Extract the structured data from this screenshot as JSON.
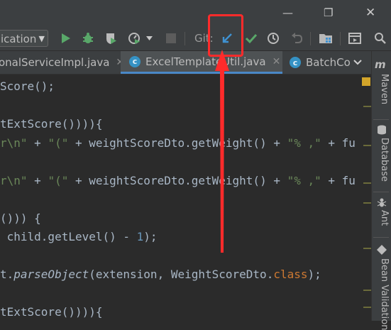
{
  "toolbar": {
    "run_config": "ication",
    "git_label": "Git:"
  },
  "tabs": [
    {
      "label": "onalServiceImpl.java",
      "icon": "java-class-icon"
    },
    {
      "label": "ExcelTemplateUtil.java",
      "icon": "java-class-icon",
      "icon_letter": "c",
      "active": true
    },
    {
      "label": "BatchCo",
      "icon": "java-class-icon",
      "icon_letter": "c"
    }
  ],
  "tool_windows": [
    "Maven",
    "Database",
    "Ant",
    "Bean Validation"
  ],
  "maven_glyph": "m",
  "code_lines": [
    [
      [
        "Score();",
        "t-tx"
      ]
    ],
    [],
    [
      [
        "tExtScore()))){",
        "t-tx"
      ]
    ],
    [
      [
        "r\\n\"",
        "t-s"
      ],
      [
        " + ",
        "t-tx"
      ],
      [
        "\"(\"",
        "t-s"
      ],
      [
        " + weightScoreDto.getWeight() + ",
        "t-tx"
      ],
      [
        "\"% ,\"",
        "t-s"
      ],
      [
        " + fu",
        "t-tx"
      ]
    ],
    [],
    [
      [
        "r\\n\"",
        "t-s"
      ],
      [
        " + ",
        "t-tx"
      ],
      [
        "\"(\"",
        "t-s"
      ],
      [
        " + weightScoreDto.getWeight() + ",
        "t-tx"
      ],
      [
        "\"% ,\"",
        "t-s"
      ],
      [
        " + fu",
        "t-tx"
      ]
    ],
    [],
    [
      [
        "())) {",
        "t-tx"
      ]
    ],
    [
      [
        " child.getLevel() - ",
        "t-tx"
      ],
      [
        "1",
        "t-n"
      ],
      [
        ");",
        "t-tx"
      ]
    ],
    [],
    [
      [
        "t.",
        "t-tx"
      ],
      [
        "parseObject",
        "t-it"
      ],
      [
        "(extension, WeightScoreDto.",
        "t-tx"
      ],
      [
        "class",
        "t-k"
      ],
      [
        ");",
        "t-tx"
      ]
    ],
    [],
    [
      [
        "tExtScore()))){",
        "t-tx"
      ]
    ]
  ],
  "colors": {
    "highlight_box": "#ff2b2b",
    "arrow": "#ff2b2b",
    "update_project_icon": "#3f92d2",
    "commit_icon": "#59a869"
  }
}
